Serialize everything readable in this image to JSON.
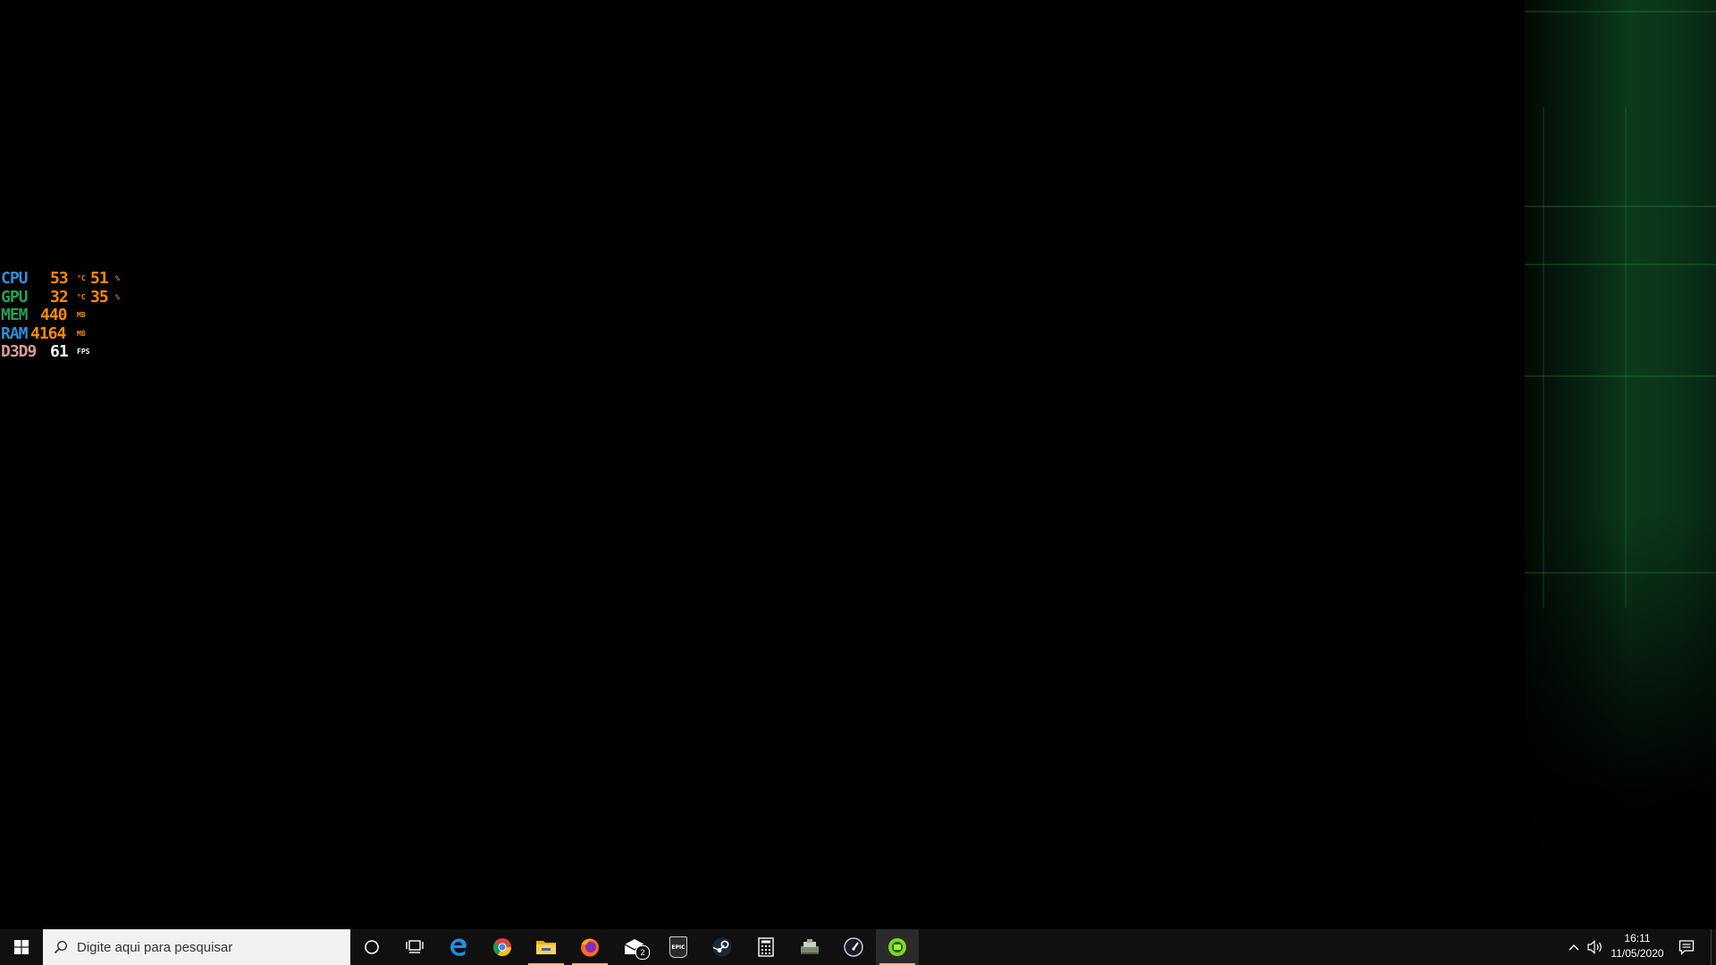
{
  "osd": {
    "rows": [
      {
        "label": "CPU",
        "label_color": "#2e8fd8",
        "v1": "53",
        "u1": "°C",
        "v2": "51",
        "u2": "%"
      },
      {
        "label": "GPU",
        "label_color": "#22a05a",
        "v1": "32",
        "u1": "°C",
        "v2": "35",
        "u2": "%"
      },
      {
        "label": "MEM",
        "label_color": "#22a05a",
        "v1": "440",
        "u1": "MB"
      },
      {
        "label": "RAM",
        "label_color": "#2e8fd8",
        "v1": "4164",
        "u1": "MB"
      },
      {
        "label": "D3D9",
        "label_color": "#d89a9a",
        "v1": "61",
        "u1": "FPS",
        "v1_color": "#ffffff"
      }
    ]
  },
  "taskbar": {
    "search_placeholder": "Digite aqui para pesquisar",
    "apps": [
      {
        "name": "cortana-icon"
      },
      {
        "name": "task-view-icon"
      },
      {
        "name": "edge-icon"
      },
      {
        "name": "chrome-icon"
      },
      {
        "name": "file-explorer-icon",
        "active": true
      },
      {
        "name": "firefox-icon",
        "active": true
      },
      {
        "name": "mail-icon",
        "badge": "2"
      },
      {
        "name": "epic-games-icon",
        "text": "EPIC"
      },
      {
        "name": "steam-icon"
      },
      {
        "name": "calculator-icon"
      },
      {
        "name": "game-app-icon"
      },
      {
        "name": "speedometer-icon"
      },
      {
        "name": "green-app-icon",
        "active": true,
        "selected": true
      }
    ],
    "mail_badge": "2",
    "epic_text": "EPIC",
    "clock": {
      "time": "16:11",
      "date": "11/05/2020"
    }
  }
}
